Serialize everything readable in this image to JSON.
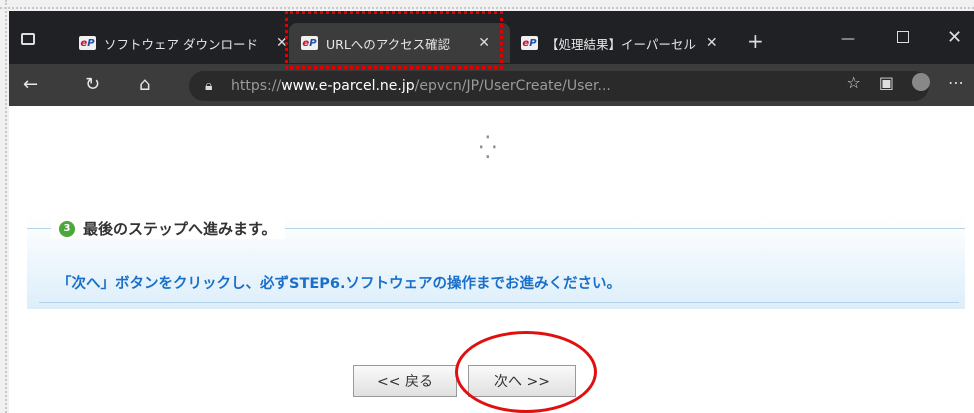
{
  "tabs": [
    {
      "label": "ソフトウェア ダウンロード"
    },
    {
      "label": "URLへのアクセス確認"
    },
    {
      "label": "【処理結果】イーパーセル"
    }
  ],
  "address": {
    "scheme": "https://",
    "host": "www.e-parcel.ne.jp",
    "path": "/epvcn/JP/UserCreate/User..."
  },
  "step": {
    "number": "3",
    "title": "最後のステップへ進みます。",
    "message": "「次へ」ボタンをクリックし、必ずSTEP6.ソフトウェアの操作までお進みください。"
  },
  "buttons": {
    "back": "<< 戻る",
    "next": "次へ >>"
  },
  "colors": {
    "accent": "#1a6fc9",
    "annotation": "#e00000"
  }
}
